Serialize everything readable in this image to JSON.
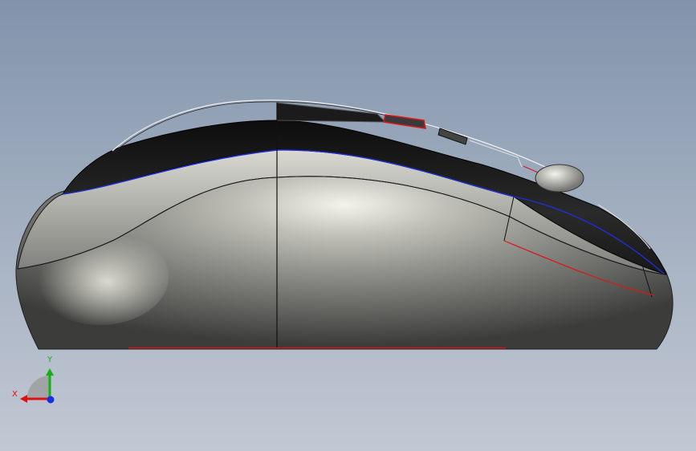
{
  "viewport": {
    "model": "computer-mouse-3d-model",
    "view": "side-elevation"
  },
  "triad": {
    "x_label": "X",
    "y_label": "Y",
    "x_color": "#e01010",
    "y_color": "#12b012",
    "z_color": "#1530e0"
  },
  "colors": {
    "edge_highlight_blue": "#1f2fd6",
    "edge_highlight_red": "#d81818",
    "body_shell": "#8a8a88",
    "top_shell": "#262626"
  }
}
